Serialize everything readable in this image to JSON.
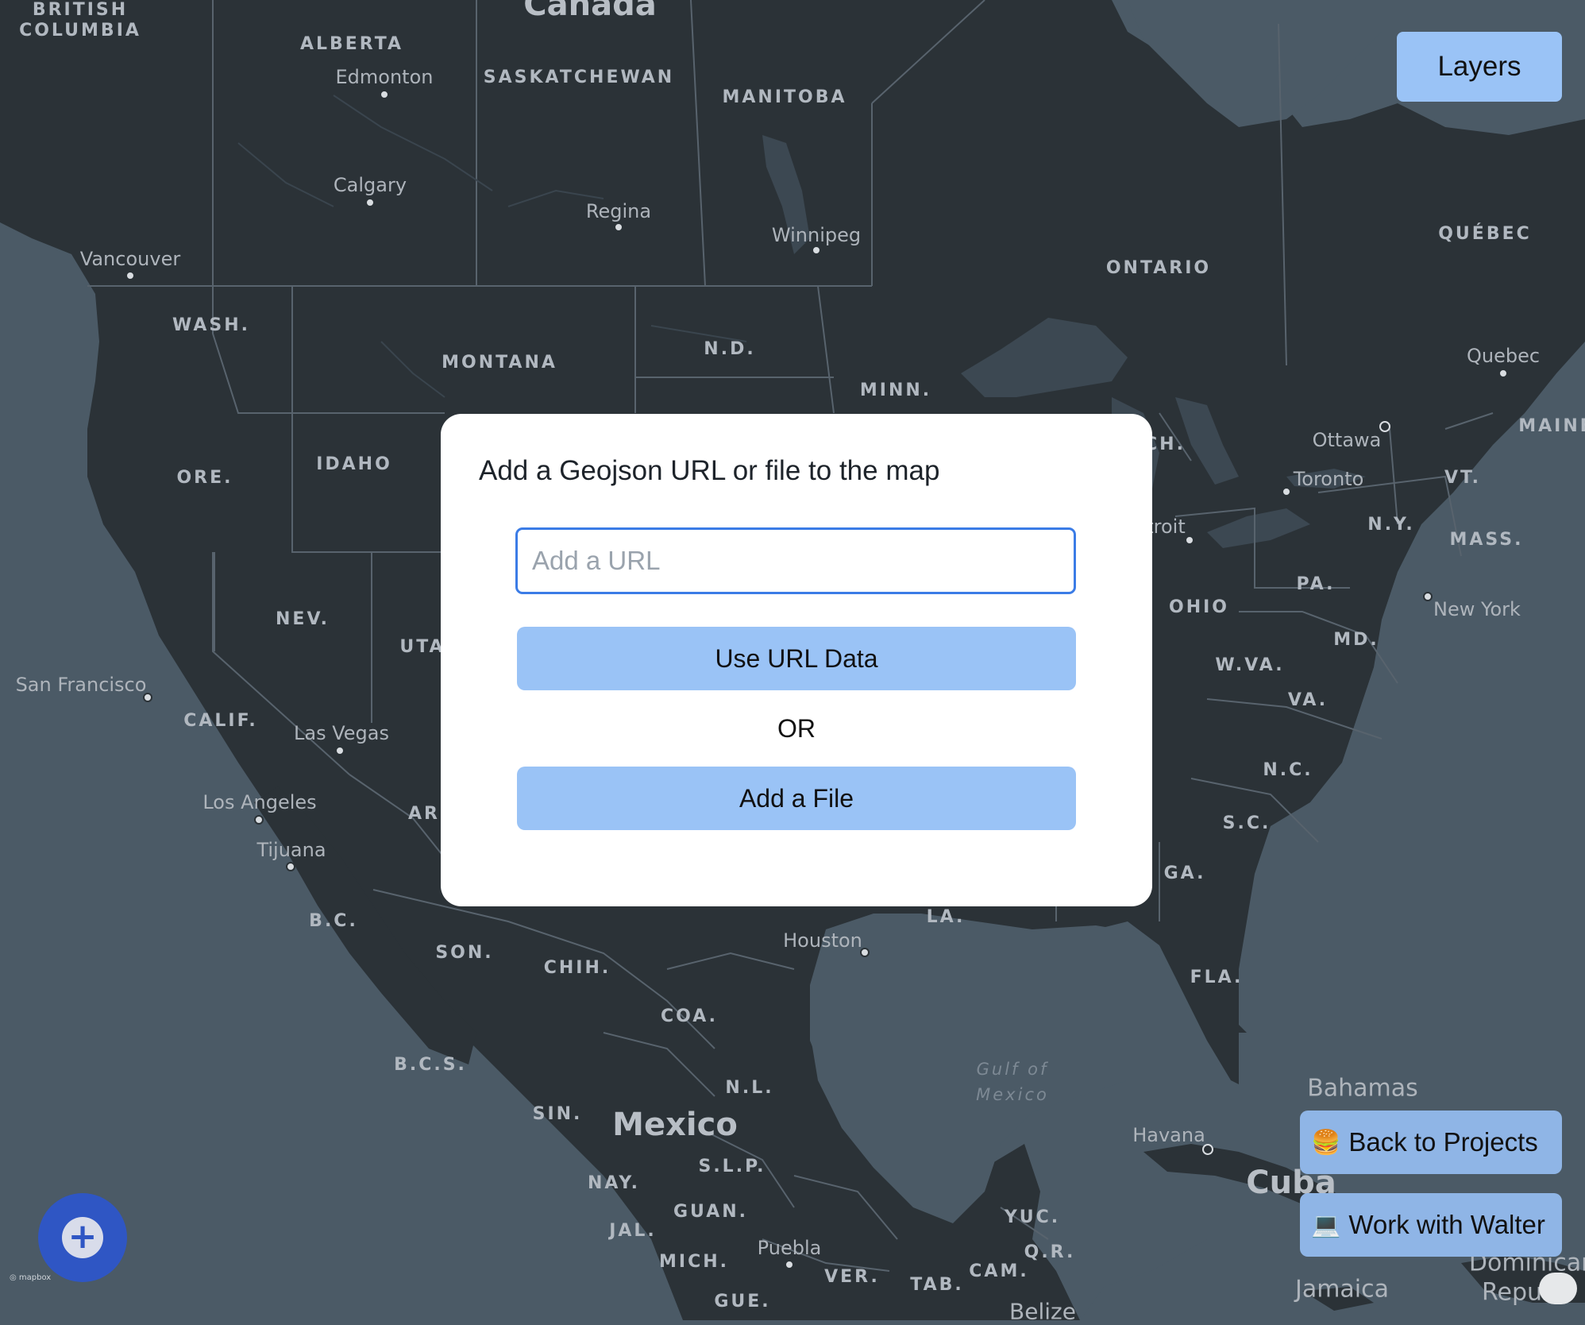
{
  "map": {
    "labels": {
      "british_columbia": "BRITISH\nCOLUMBIA",
      "alberta": "ALBERTA",
      "saskatchewan": "SASKATCHEWAN",
      "manitoba": "MANITOBA",
      "canada": "Canada",
      "ontario": "ONTARIO",
      "quebec_prov": "QUÉBEC",
      "maine": "MAINE",
      "wash": "WASH.",
      "montana": "MONTANA",
      "nd": "N.D.",
      "minn": "MINN.",
      "mich": "CH.",
      "ore": "ORE.",
      "idaho": "IDAHO",
      "nev": "NEV.",
      "utah": "UTA",
      "calif": "CALIF.",
      "ariz": "AR",
      "ohio": "OHIO",
      "pa": "PA.",
      "ny": "N.Y.",
      "vt": "VT.",
      "mass": "MASS.",
      "md": "MD.",
      "wva": "W.VA.",
      "va": "VA.",
      "nc": "N.C.",
      "sc": "S.C.",
      "ga": "GA.",
      "fla": "FLA.",
      "la": "LA.",
      "bc_mx": "B.C.",
      "son": "SON.",
      "chih": "CHIH.",
      "coa": "COA.",
      "bcs": "B.C.S.",
      "nl": "N.L.",
      "sin": "SIN.",
      "slp": "S.L.P.",
      "nay": "NAY.",
      "guan": "GUAN.",
      "jal": "JAL.",
      "mich_mx": "MICH.",
      "ver": "VER.",
      "tab": "TAB.",
      "cam": "CAM.",
      "yuc": "YUC.",
      "qr": "Q.R.",
      "gue": "GUE.",
      "mexico": "Mexico",
      "cuba": "Cuba",
      "gulf": "Gulf of\nMexico"
    },
    "cities": {
      "edmonton": "Edmonton",
      "calgary": "Calgary",
      "regina": "Regina",
      "winnipeg": "Winnipeg",
      "vancouver": "Vancouver",
      "ottawa": "Ottawa",
      "quebec": "Quebec",
      "toronto": "Toronto",
      "detroit": "troit",
      "new_york": "New York",
      "san_francisco": "San Francisco",
      "las_vegas": "Las Vegas",
      "los_angeles": "Los Angeles",
      "tijuana": "Tijuana",
      "houston": "Houston",
      "havana": "Havana",
      "bahamas": "Bahamas",
      "puebla": "Puebla",
      "belize": "Belize",
      "jamaica": "Jamaica",
      "dominican": "Dominican",
      "republic": "Repu"
    },
    "attribution": "◎ mapbox"
  },
  "toolbar": {
    "layers_label": "Layers"
  },
  "dialog": {
    "title": "Add a Geojson URL or file to the map",
    "url_placeholder": "Add a URL",
    "url_value": "",
    "use_url_label": "Use URL Data",
    "or_label": "OR",
    "add_file_label": "Add a File"
  },
  "actions": {
    "back_emoji": "🍔",
    "back_label": "Back to Projects",
    "walter_emoji": "💻",
    "walter_label": "Work with Walter",
    "add_fab_label": "+"
  },
  "colors": {
    "land": "#2b3237",
    "water": "#4b5a66",
    "accent_button": "#9ac3f6",
    "fab": "#2f56c4",
    "input_border": "#3b7ce6"
  }
}
